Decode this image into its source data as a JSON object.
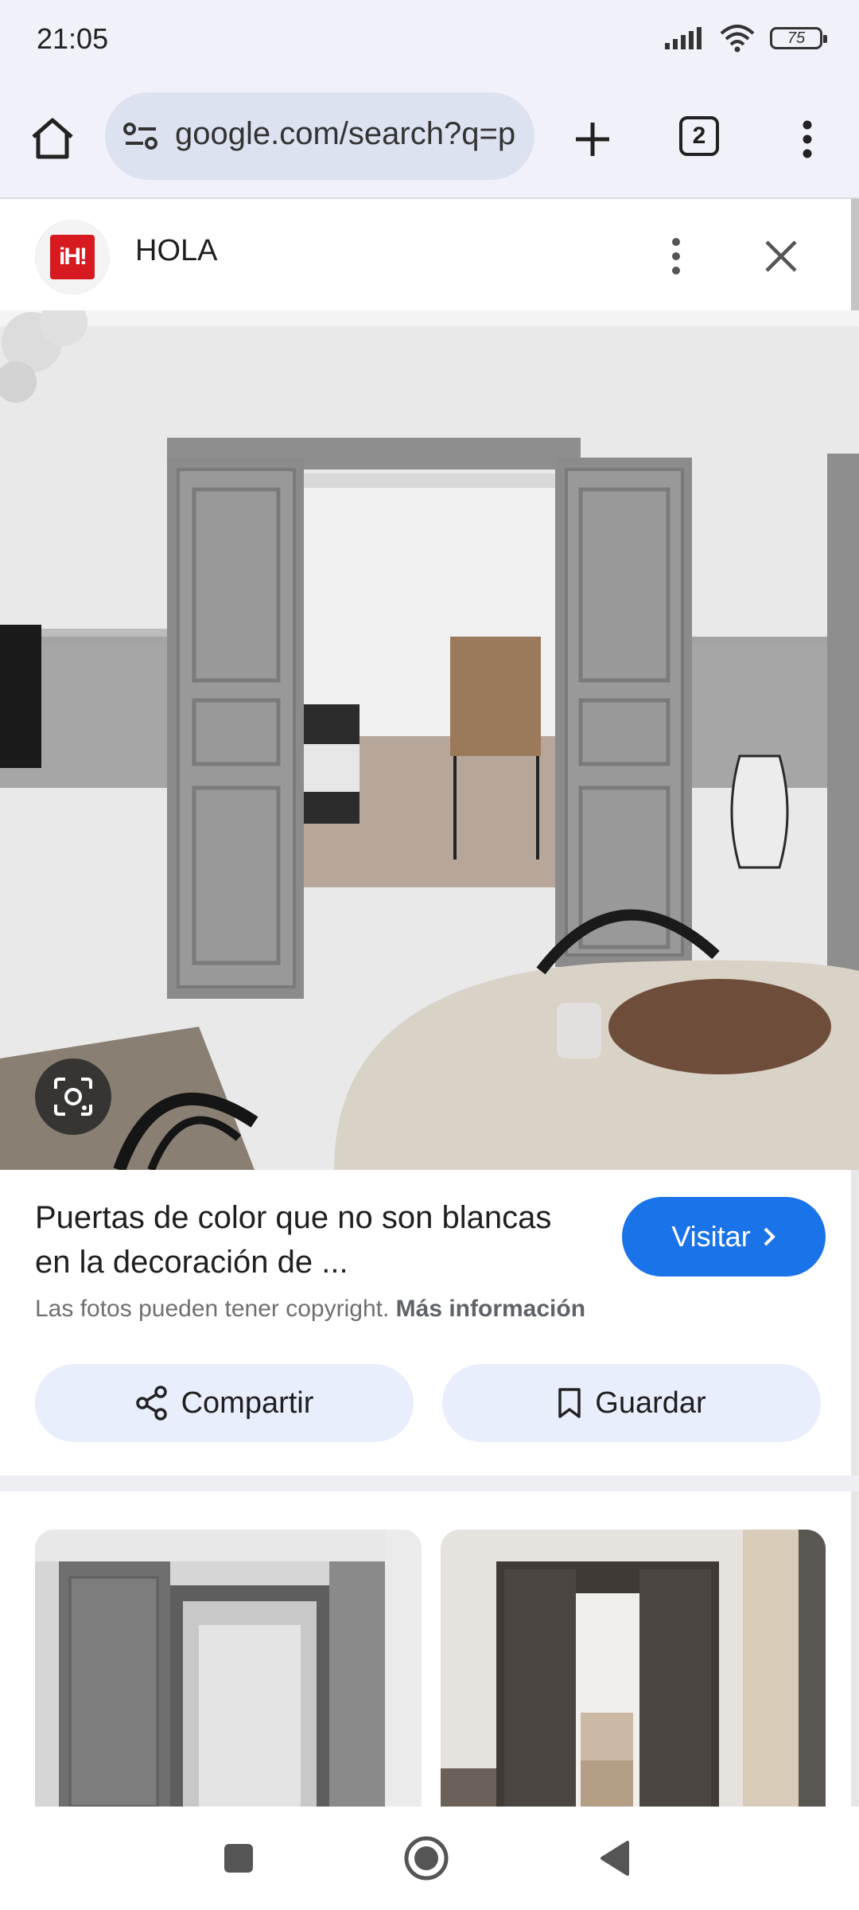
{
  "status": {
    "time": "21:05",
    "battery": "75"
  },
  "browser": {
    "url": "google.com/search?q=p",
    "tab_count": "2"
  },
  "source": {
    "name": "HOLA",
    "logo_text": "iH!"
  },
  "result": {
    "title": "Puertas de color que no son blancas en la decoración de ...",
    "visit_label": "Visitar",
    "copyright_text": "Las fotos pueden tener copyright.",
    "more_info_label": "Más información"
  },
  "actions": {
    "share_label": "Compartir",
    "save_label": "Guardar"
  },
  "colors": {
    "accent": "#1a73e8",
    "chip_bg": "#e8eefb",
    "toolbar_bg": "#f1f2f9",
    "logo_red": "#d71920"
  },
  "icons": {
    "home": "home-icon",
    "site_info": "tune-icon",
    "new_tab": "plus-icon",
    "tabs": "tab-switcher-icon",
    "menu": "more-vert-icon",
    "close": "close-icon",
    "lens": "google-lens-icon",
    "share": "share-icon",
    "save": "bookmark-icon",
    "chevron": "chevron-right-icon"
  }
}
